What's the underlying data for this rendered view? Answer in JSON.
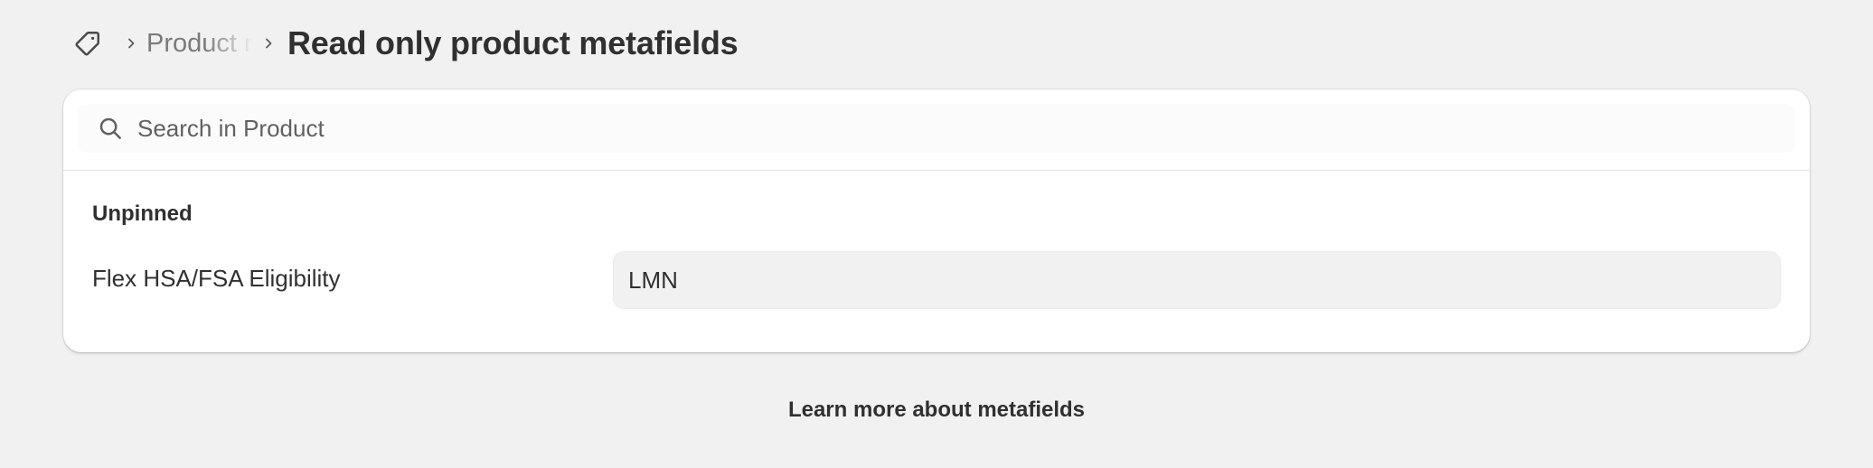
{
  "breadcrumb": {
    "icon": "tag-icon",
    "parent_label": "Product metafields",
    "separator_icon": "chevron-right-icon"
  },
  "page_title": "Read only product metafields",
  "search": {
    "icon": "search-icon",
    "placeholder": "Search in Product",
    "value": ""
  },
  "section": {
    "heading": "Unpinned",
    "fields": [
      {
        "label": "Flex HSA/FSA Eligibility",
        "value": "LMN"
      }
    ]
  },
  "footer": {
    "learn_more_label": "Learn more about metafields"
  },
  "colors": {
    "page_background": "#f1f1f1",
    "card_background": "#ffffff",
    "text_primary": "#303030",
    "text_secondary": "#616161",
    "field_background": "#f1f1f1"
  }
}
